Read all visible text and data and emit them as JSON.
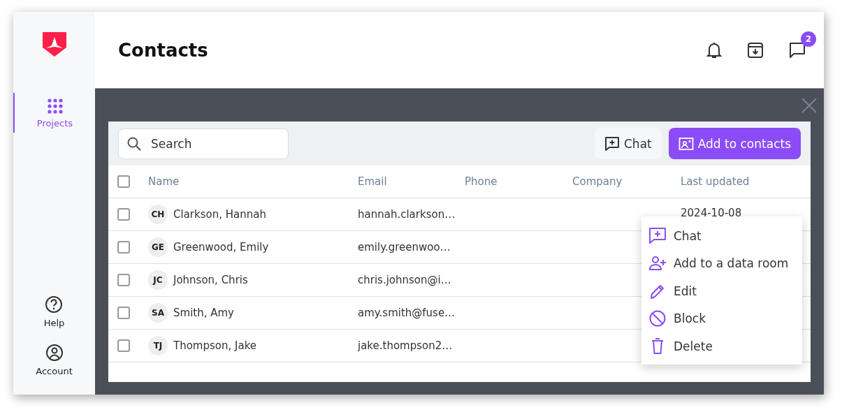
{
  "header": {
    "title": "Contacts",
    "message_badge": "2"
  },
  "sidebar": {
    "items": [
      {
        "label": "Projects",
        "kind": "grid",
        "selected": true
      }
    ],
    "bottom_items": [
      {
        "label": "Help",
        "kind": "help"
      },
      {
        "label": "Account",
        "kind": "account"
      }
    ]
  },
  "toolbar": {
    "search": {
      "placeholder": "Search"
    },
    "chat_button": "Chat",
    "add_button": "Add to contacts"
  },
  "table": {
    "columns": [
      "Name",
      "Email",
      "Phone",
      "Company",
      "Last updated"
    ],
    "select_all": {
      "checked": false
    },
    "rows": [
      {
        "initials": "CH",
        "name": "Clarkson, Hannah",
        "email": "hannah.clarkson…",
        "phone": "",
        "company": "",
        "updated": "2024-10-08",
        "checked": false
      },
      {
        "initials": "GE",
        "name": "Greenwood, Emily",
        "email": "emily.greenwoo…",
        "phone": "",
        "company": "",
        "updated": "",
        "checked": false
      },
      {
        "initials": "JC",
        "name": "Johnson, Chris",
        "email": "chris.johnson@i…",
        "phone": "",
        "company": "",
        "updated": "",
        "checked": false
      },
      {
        "initials": "SA",
        "name": "Smith, Amy",
        "email": "amy.smith@fuse…",
        "phone": "",
        "company": "",
        "updated": "",
        "checked": false
      },
      {
        "initials": "TJ",
        "name": "Thompson, Jake",
        "email": "jake.thompson2…",
        "phone": "",
        "company": "",
        "updated": "",
        "checked": false
      }
    ]
  },
  "context_menu": {
    "items": [
      {
        "label": "Chat",
        "kind": "chat"
      },
      {
        "label": "Add to a data room",
        "kind": "add-person"
      },
      {
        "label": "Edit",
        "kind": "edit"
      },
      {
        "label": "Block",
        "kind": "block"
      },
      {
        "label": "Delete",
        "kind": "delete"
      }
    ]
  }
}
